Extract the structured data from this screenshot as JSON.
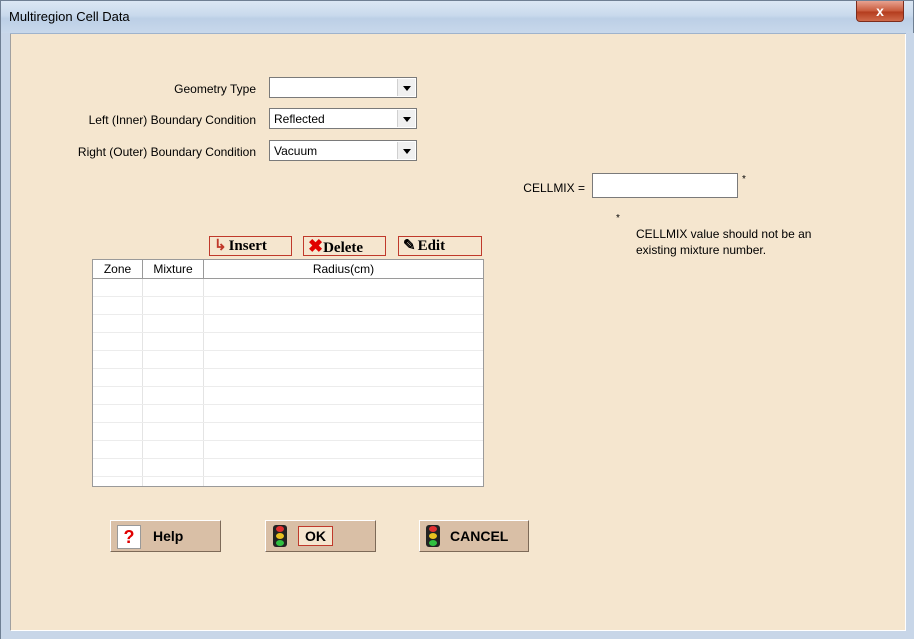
{
  "window": {
    "title": "Multiregion Cell Data",
    "close_label": "x"
  },
  "form": {
    "geometry_type": {
      "label": "Geometry Type",
      "value": ""
    },
    "left_bc": {
      "label": "Left (Inner) Boundary Condition",
      "value": "Reflected"
    },
    "right_bc": {
      "label": "Right (Outer)  Boundary Condition",
      "value": "Vacuum"
    },
    "cellmix": {
      "label": "CELLMIX =",
      "value": "",
      "asterisk": "*"
    },
    "note": {
      "asterisk": "*",
      "text_line1": "CELLMIX value should not be an",
      "text_line2": "existing mixture number."
    }
  },
  "toolbar": {
    "insert_label": "Insert",
    "delete_label": "Delete",
    "edit_label": "Edit"
  },
  "grid": {
    "columns": [
      "Zone",
      "Mixture",
      "Radius(cm)"
    ],
    "rows": []
  },
  "buttons": {
    "help_label": "Help",
    "ok_label": "OK",
    "cancel_label": "CANCEL"
  },
  "icons": {
    "help": "question-mark-icon",
    "ok": "traffic-light-icon",
    "cancel": "traffic-light-icon",
    "insert": "insert-arrow-icon",
    "delete": "delete-x-icon",
    "edit": "edit-pencil-icon"
  },
  "colors": {
    "accent_red": "#c0392b",
    "background": "#f5e6cf",
    "button_face": "#d9bfa6"
  }
}
